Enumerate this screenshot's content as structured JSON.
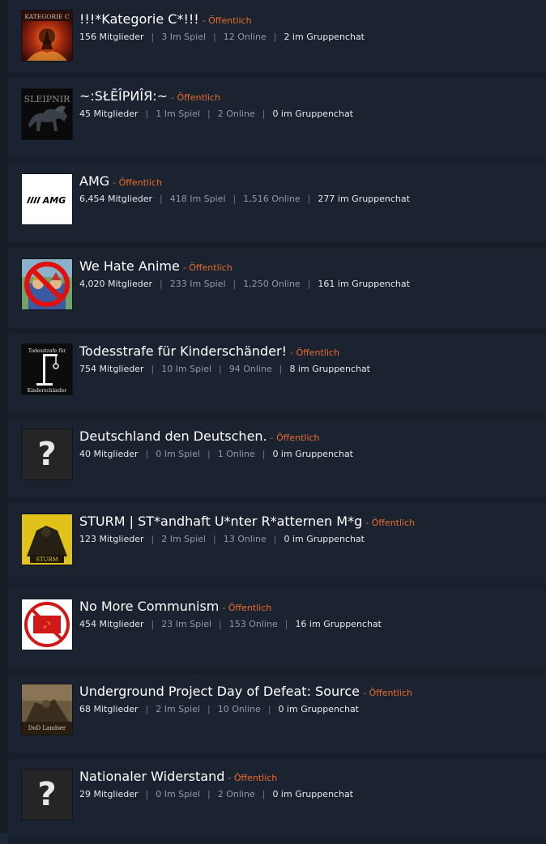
{
  "groups": [
    {
      "name": "!!!*Kategorie C*!!!",
      "visibility": "- Öffentlich",
      "members": "156 Mitglieder",
      "in_game": "3 Im Spiel",
      "online": "12 Online",
      "chat": "2 im Gruppenchat",
      "avatar_text": "KATEGORIE C"
    },
    {
      "name": "~:SŁĒÎPИÎЯ:~",
      "visibility": "- Öffentlich",
      "members": "45 Mitglieder",
      "in_game": "1 Im Spiel",
      "online": "2 Online",
      "chat": "0 im Gruppenchat",
      "avatar_text": "SLEIPNIR"
    },
    {
      "name": "AMG",
      "visibility": "- Öffentlich",
      "members": "6,454 Mitglieder",
      "in_game": "418 Im Spiel",
      "online": "1,516 Online",
      "chat": "277 im Gruppenchat",
      "avatar_text": "AMG"
    },
    {
      "name": "We Hate Anime",
      "visibility": "- Öffentlich",
      "members": "4,020 Mitglieder",
      "in_game": "233 Im Spiel",
      "online": "1,250 Online",
      "chat": "161 im Gruppenchat",
      "avatar_text": ""
    },
    {
      "name": "Todesstrafe für Kinderschänder!",
      "visibility": "- Öffentlich",
      "members": "754 Mitglieder",
      "in_game": "10 Im Spiel",
      "online": "94 Online",
      "chat": "8 im Gruppenchat",
      "avatar_text": "Todesstrafe für Kinderschänder"
    },
    {
      "name": "Deutschland den Deutschen.",
      "visibility": "- Öffentlich",
      "members": "40 Mitglieder",
      "in_game": "0 Im Spiel",
      "online": "1 Online",
      "chat": "0 im Gruppenchat",
      "avatar_text": "?"
    },
    {
      "name": "STURM | ST*andhaft U*nter R*atternen M*g",
      "visibility": "- Öffentlich",
      "members": "123 Mitglieder",
      "in_game": "2 Im Spiel",
      "online": "13 Online",
      "chat": "0 im Gruppenchat",
      "avatar_text": "STURM"
    },
    {
      "name": "No More Communism",
      "visibility": "- Öffentlich",
      "members": "454 Mitglieder",
      "in_game": "23 Im Spiel",
      "online": "153 Online",
      "chat": "16 im Gruppenchat",
      "avatar_text": ""
    },
    {
      "name": "Underground Project Day of Defeat: Source",
      "visibility": "- Öffentlich",
      "members": "68 Mitglieder",
      "in_game": "2 Im Spiel",
      "online": "10 Online",
      "chat": "0 im Gruppenchat",
      "avatar_text": "DoD Landser"
    },
    {
      "name": "Nationaler Widerstand",
      "visibility": "- Öffentlich",
      "members": "29 Mitglieder",
      "in_game": "0 Im Spiel",
      "online": "2 Online",
      "chat": "0 im Gruppenchat",
      "avatar_text": "?"
    }
  ],
  "colors": {
    "background": "#1b2838",
    "row": "#1c2330",
    "name": "#ffffff",
    "visibility": "#e96c2c",
    "stat_muted": "#8e9aa6"
  },
  "icons": {
    "placeholder": "question-mark-icon"
  }
}
